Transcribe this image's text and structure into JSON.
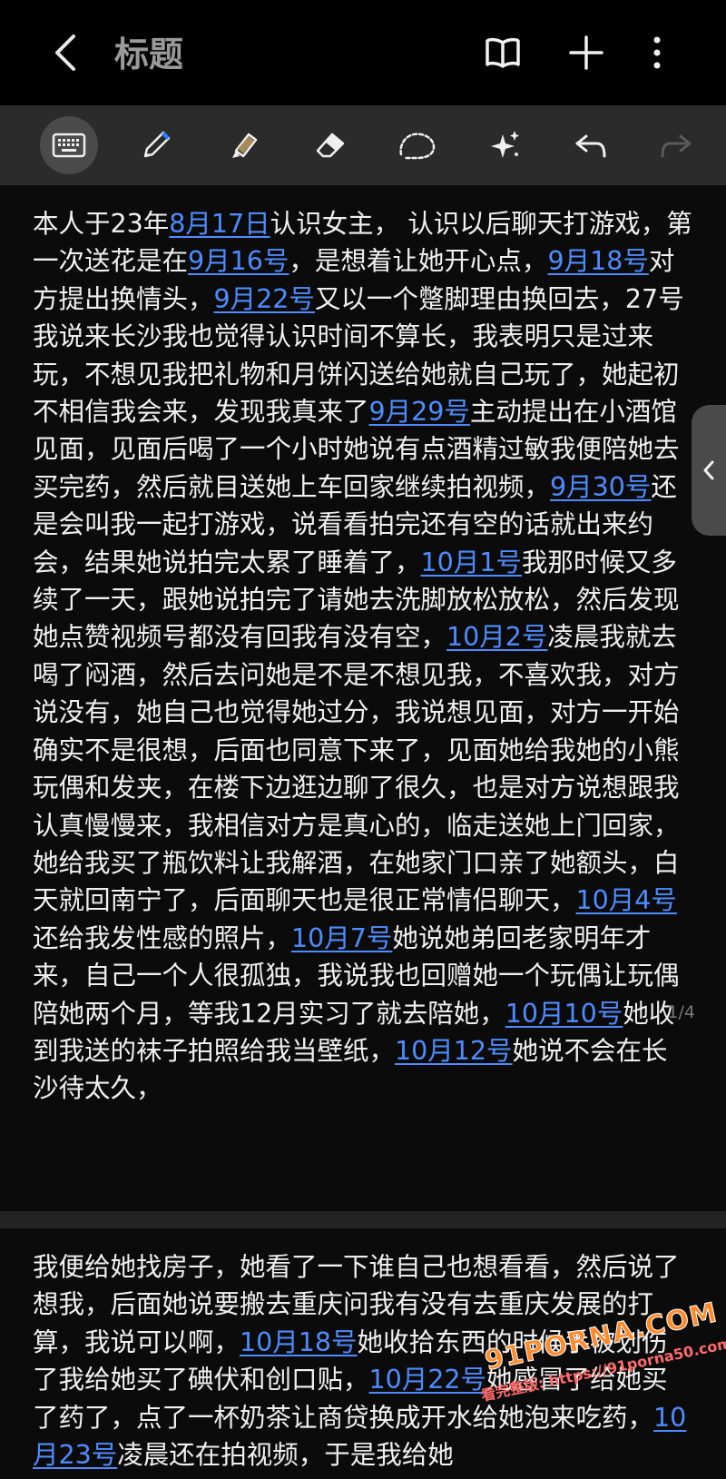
{
  "header": {
    "title": "标题",
    "icons": [
      "back-arrow-icon",
      "book-icon",
      "plus-icon",
      "more-vertical-icon"
    ]
  },
  "toolbar": {
    "tools": [
      "keyboard-icon",
      "pen-icon",
      "highlighter-icon",
      "eraser-icon",
      "lasso-icon",
      "sparkle-icon",
      "undo-icon",
      "redo-icon"
    ],
    "active_tool": "keyboard-icon"
  },
  "note": {
    "page_one": [
      {
        "t": "本人于23年"
      },
      {
        "t": "8月17日",
        "link": true
      },
      {
        "t": "认识女主， 认识以后聊天打游戏，第一次送花是在"
      },
      {
        "t": "9月16号",
        "link": true
      },
      {
        "t": "，是想着让她开心点，"
      },
      {
        "t": "9月18号",
        "link": true
      },
      {
        "t": "对方提出换情头，"
      },
      {
        "t": "9月22号",
        "link": true
      },
      {
        "t": "又以一个蹩脚理由换回去，27号我说来长沙我也觉得认识时间不算长，我表明只是过来玩，不想见我把礼物和月饼闪送给她就自己玩了，她起初不相信我会来，发现我真来了"
      },
      {
        "t": "9月29号",
        "link": true
      },
      {
        "t": "主动提出在小酒馆见面，见面后喝了一个小时她说有点酒精过敏我便陪她去买完药，然后就目送她上车回家继续拍视频，"
      },
      {
        "t": "9月30号",
        "link": true
      },
      {
        "t": "还是会叫我一起打游戏，说看看拍完还有空的话就出来约会，结果她说拍完太累了睡着了，"
      },
      {
        "t": "10月1号",
        "link": true
      },
      {
        "t": "我那时候又多续了一天，跟她说拍完了请她去洗脚放松放松，然后发现她点赞视频号都没有回我有没有空，"
      },
      {
        "t": "10月2号",
        "link": true
      },
      {
        "t": "凌晨我就去喝了闷酒，然后去问她是不是不想见我，不喜欢我，对方说没有，她自己也觉得她过分，我说想见面，对方一开始确实不是很想，后面也同意下来了，见面她给我她的小熊玩偶和发夹，在楼下边逛边聊了很久，也是对方说想跟我认真慢慢来，我相信对方是真心的，临走送她上门回家，她给我买了瓶饮料让我解酒，在她家门口亲了她额头，白天就回南宁了，后面聊天也是很正常情侣聊天，"
      },
      {
        "t": "10月4号",
        "link": true
      },
      {
        "t": "还给我发性感的照片，"
      },
      {
        "t": "10月7号",
        "link": true
      },
      {
        "t": "她说她弟回老家明年才来，自己一个人很孤独，我说我也回赠她一个玩偶让玩偶陪她两个月，等我12月实习了就去陪她，"
      },
      {
        "t": "10月10号",
        "link": true
      },
      {
        "t": "她收到我送的袜子拍照给我当壁纸，"
      },
      {
        "t": "10月12号",
        "link": true
      },
      {
        "t": "她说不会在长沙待太久，"
      }
    ],
    "page_indicator": "1/4",
    "page_two": [
      {
        "t": "我便给她找房子，她看了一下谁自己也想看看，然后说了想我，后面她说要搬去重庆问我有没有去重庆发展的打算，我说可以啊，"
      },
      {
        "t": "10月18号",
        "link": true
      },
      {
        "t": "她收拾东西的时候手被划伤了我给她买了碘伏和创口贴，"
      },
      {
        "t": "10月22号",
        "link": true
      },
      {
        "t": "她感冒了给她买了药了，点了一杯奶茶让商贷换成开水给她泡来吃药，"
      },
      {
        "t": "10月23号",
        "link": true
      },
      {
        "t": "凌晨还在拍视频，于是我给她"
      }
    ]
  },
  "watermark": {
    "logo": "91PORNA.COM",
    "url": "看完整版: https://91porna50.com"
  },
  "colors": {
    "background": "#000000",
    "toolbar": "#2b2b2b",
    "link": "#4d8cff",
    "text": "#f0f0f0",
    "title": "#9a9a9a"
  }
}
